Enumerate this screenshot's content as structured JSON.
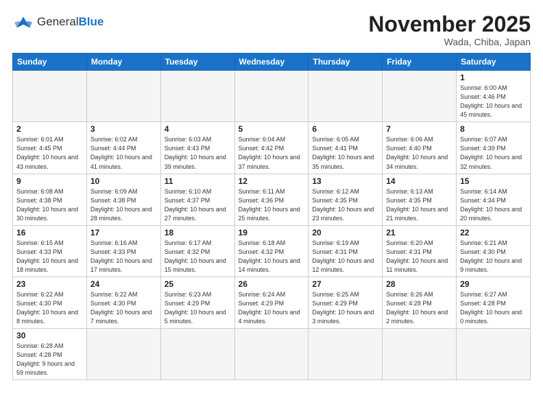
{
  "logo": {
    "text_general": "General",
    "text_blue": "Blue"
  },
  "title": "November 2025",
  "location": "Wada, Chiba, Japan",
  "weekdays": [
    "Sunday",
    "Monday",
    "Tuesday",
    "Wednesday",
    "Thursday",
    "Friday",
    "Saturday"
  ],
  "weeks": [
    [
      null,
      null,
      null,
      null,
      null,
      null,
      {
        "day": "1",
        "sunrise": "6:00 AM",
        "sunset": "4:46 PM",
        "daylight": "10 hours and 45 minutes."
      }
    ],
    [
      {
        "day": "2",
        "sunrise": "6:01 AM",
        "sunset": "4:45 PM",
        "daylight": "10 hours and 43 minutes."
      },
      {
        "day": "3",
        "sunrise": "6:02 AM",
        "sunset": "4:44 PM",
        "daylight": "10 hours and 41 minutes."
      },
      {
        "day": "4",
        "sunrise": "6:03 AM",
        "sunset": "4:43 PM",
        "daylight": "10 hours and 39 minutes."
      },
      {
        "day": "5",
        "sunrise": "6:04 AM",
        "sunset": "4:42 PM",
        "daylight": "10 hours and 37 minutes."
      },
      {
        "day": "6",
        "sunrise": "6:05 AM",
        "sunset": "4:41 PM",
        "daylight": "10 hours and 35 minutes."
      },
      {
        "day": "7",
        "sunrise": "6:06 AM",
        "sunset": "4:40 PM",
        "daylight": "10 hours and 34 minutes."
      },
      {
        "day": "8",
        "sunrise": "6:07 AM",
        "sunset": "4:39 PM",
        "daylight": "10 hours and 32 minutes."
      }
    ],
    [
      {
        "day": "9",
        "sunrise": "6:08 AM",
        "sunset": "4:38 PM",
        "daylight": "10 hours and 30 minutes."
      },
      {
        "day": "10",
        "sunrise": "6:09 AM",
        "sunset": "4:38 PM",
        "daylight": "10 hours and 28 minutes."
      },
      {
        "day": "11",
        "sunrise": "6:10 AM",
        "sunset": "4:37 PM",
        "daylight": "10 hours and 27 minutes."
      },
      {
        "day": "12",
        "sunrise": "6:11 AM",
        "sunset": "4:36 PM",
        "daylight": "10 hours and 25 minutes."
      },
      {
        "day": "13",
        "sunrise": "6:12 AM",
        "sunset": "4:35 PM",
        "daylight": "10 hours and 23 minutes."
      },
      {
        "day": "14",
        "sunrise": "6:13 AM",
        "sunset": "4:35 PM",
        "daylight": "10 hours and 21 minutes."
      },
      {
        "day": "15",
        "sunrise": "6:14 AM",
        "sunset": "4:34 PM",
        "daylight": "10 hours and 20 minutes."
      }
    ],
    [
      {
        "day": "16",
        "sunrise": "6:15 AM",
        "sunset": "4:33 PM",
        "daylight": "10 hours and 18 minutes."
      },
      {
        "day": "17",
        "sunrise": "6:16 AM",
        "sunset": "4:33 PM",
        "daylight": "10 hours and 17 minutes."
      },
      {
        "day": "18",
        "sunrise": "6:17 AM",
        "sunset": "4:32 PM",
        "daylight": "10 hours and 15 minutes."
      },
      {
        "day": "19",
        "sunrise": "6:18 AM",
        "sunset": "4:32 PM",
        "daylight": "10 hours and 14 minutes."
      },
      {
        "day": "20",
        "sunrise": "6:19 AM",
        "sunset": "4:31 PM",
        "daylight": "10 hours and 12 minutes."
      },
      {
        "day": "21",
        "sunrise": "6:20 AM",
        "sunset": "4:31 PM",
        "daylight": "10 hours and 11 minutes."
      },
      {
        "day": "22",
        "sunrise": "6:21 AM",
        "sunset": "4:30 PM",
        "daylight": "10 hours and 9 minutes."
      }
    ],
    [
      {
        "day": "23",
        "sunrise": "6:22 AM",
        "sunset": "4:30 PM",
        "daylight": "10 hours and 8 minutes."
      },
      {
        "day": "24",
        "sunrise": "6:22 AM",
        "sunset": "4:30 PM",
        "daylight": "10 hours and 7 minutes."
      },
      {
        "day": "25",
        "sunrise": "6:23 AM",
        "sunset": "4:29 PM",
        "daylight": "10 hours and 5 minutes."
      },
      {
        "day": "26",
        "sunrise": "6:24 AM",
        "sunset": "4:29 PM",
        "daylight": "10 hours and 4 minutes."
      },
      {
        "day": "27",
        "sunrise": "6:25 AM",
        "sunset": "4:29 PM",
        "daylight": "10 hours and 3 minutes."
      },
      {
        "day": "28",
        "sunrise": "6:26 AM",
        "sunset": "4:28 PM",
        "daylight": "10 hours and 2 minutes."
      },
      {
        "day": "29",
        "sunrise": "6:27 AM",
        "sunset": "4:28 PM",
        "daylight": "10 hours and 0 minutes."
      }
    ],
    [
      {
        "day": "30",
        "sunrise": "6:28 AM",
        "sunset": "4:28 PM",
        "daylight": "9 hours and 59 minutes."
      },
      null,
      null,
      null,
      null,
      null,
      null
    ]
  ]
}
